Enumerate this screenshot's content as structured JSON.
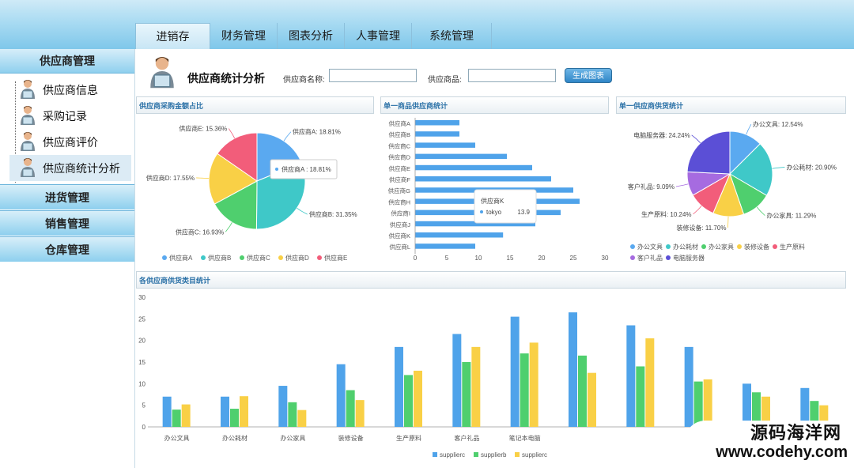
{
  "nav": {
    "tabs": [
      {
        "label": "进销存"
      },
      {
        "label": "财务管理"
      },
      {
        "label": "图表分析"
      },
      {
        "label": "人事管理"
      },
      {
        "label": "系统管理"
      }
    ]
  },
  "sidebar": {
    "header": "供应商管理",
    "items": [
      {
        "label": "供应商信息"
      },
      {
        "label": "采购记录"
      },
      {
        "label": "供应商评价"
      },
      {
        "label": "供应商统计分析"
      }
    ],
    "groups": [
      {
        "label": "进货管理"
      },
      {
        "label": "销售管理"
      },
      {
        "label": "仓库管理"
      }
    ]
  },
  "page": {
    "title": "供应商统计分析",
    "supplier_name_label": "供应商名称:",
    "supplier_name_value": "",
    "product_label": "供应商品:",
    "product_value": "",
    "generate_button": "生成图表"
  },
  "panels": {
    "pie1_title": "供应商采购金额占比",
    "bar1_title": "单一商品供应商统计",
    "pie2_title": "单一供应商供货统计",
    "bar2_title": "各供应商供货类目统计"
  },
  "watermark": {
    "line1": "源码海洋网",
    "line2": "www.codehy.com"
  },
  "chart_data": [
    {
      "type": "pie",
      "title": "供应商采购金额占比",
      "labels": [
        "供应商A",
        "供应商B",
        "供应商C",
        "供应商D",
        "供应商E"
      ],
      "values": [
        18.81,
        31.35,
        16.93,
        17.55,
        15.36
      ],
      "slice_labels": [
        "供应商A: 18.81%",
        "供应商B: 31.35%",
        "供应商C: 16.93%",
        "供应商D: 17.55%",
        "供应商E: 15.36%"
      ],
      "colors": [
        "#5aa9f0",
        "#3fc8c8",
        "#4fcf6e",
        "#f9d046",
        "#f25d7a"
      ],
      "legend": [
        "供应商A",
        "供应商B",
        "供应商C",
        "供应商D",
        "供应商E"
      ],
      "legend_position": "bottom",
      "tooltip": "供应商A : 18.81%"
    },
    {
      "type": "bar",
      "orientation": "horizontal",
      "title": "单一商品供应商统计",
      "categories": [
        "供应商A",
        "供应商B",
        "供应商C",
        "供应商D",
        "供应商E",
        "供应商F",
        "供应商G",
        "供应商H",
        "供应商I",
        "供应商J",
        "供应商K",
        "供应商L"
      ],
      "values": [
        7,
        7,
        9.5,
        14.5,
        18.5,
        21.5,
        25,
        26,
        23,
        19,
        13.9,
        9.5
      ],
      "xlim": [
        0,
        30
      ],
      "xticks": [
        "0",
        "5",
        "10",
        "15",
        "20",
        "25",
        "30"
      ],
      "color": "#4fa3ea",
      "tooltip_title": "供应商K",
      "tooltip_series": "tokyo",
      "tooltip_value": "13.9"
    },
    {
      "type": "pie",
      "title": "单一供应商供货统计",
      "labels": [
        "办公文具",
        "办公耗材",
        "办公家具",
        "装修设备",
        "生产原料",
        "客户礼品",
        "电脑服务器"
      ],
      "values": [
        12.54,
        20.9,
        11.29,
        11.7,
        10.24,
        9.09,
        24.24
      ],
      "slice_labels": [
        "办公文具: 12.54%",
        "办公耗材: 20.90%",
        "办公家具: 11.29%",
        "装修设备: 11.70%",
        "生产原料: 10.24%",
        "客户礼品: 9.09%",
        "电脑服务器: 24.24%"
      ],
      "colors": [
        "#5aa9f0",
        "#3fc8c8",
        "#4fcf6e",
        "#f9d046",
        "#f25d7a",
        "#a66be0",
        "#5b4fd6"
      ],
      "legend": [
        "办公文具",
        "办公耗材",
        "办公家具",
        "装修设备",
        "生产原料",
        "客户礼品",
        "电脑服务器"
      ],
      "legend_position": "bottom"
    },
    {
      "type": "bar",
      "title": "各供应商供货类目统计",
      "categories": [
        "办公文具",
        "办公耗材",
        "办公家具",
        "装修设备",
        "生产原料",
        "客户礼品",
        "笔记本电脑",
        "",
        "",
        "",
        "",
        ""
      ],
      "series": [
        {
          "name": "supplierc",
          "values": [
            7,
            7,
            9.5,
            14.5,
            18.5,
            21.5,
            25.5,
            26.5,
            23.5,
            18.5,
            10,
            9
          ]
        },
        {
          "name": "supplierb",
          "values": [
            4,
            4.2,
            5.7,
            8.5,
            12,
            15,
            17,
            16.5,
            14,
            10.5,
            8,
            6
          ]
        },
        {
          "name": "supplierc",
          "values": [
            5.2,
            7.1,
            3.9,
            6.2,
            13,
            18.5,
            19.5,
            12.5,
            20.5,
            11,
            7,
            5
          ]
        }
      ],
      "colors": [
        "#4fa3ea",
        "#4fcf6e",
        "#f9d046"
      ],
      "ylim": [
        0,
        30
      ],
      "yticks": [
        "0",
        "5",
        "10",
        "15",
        "20",
        "25",
        "30"
      ],
      "legend_position": "bottom"
    }
  ]
}
